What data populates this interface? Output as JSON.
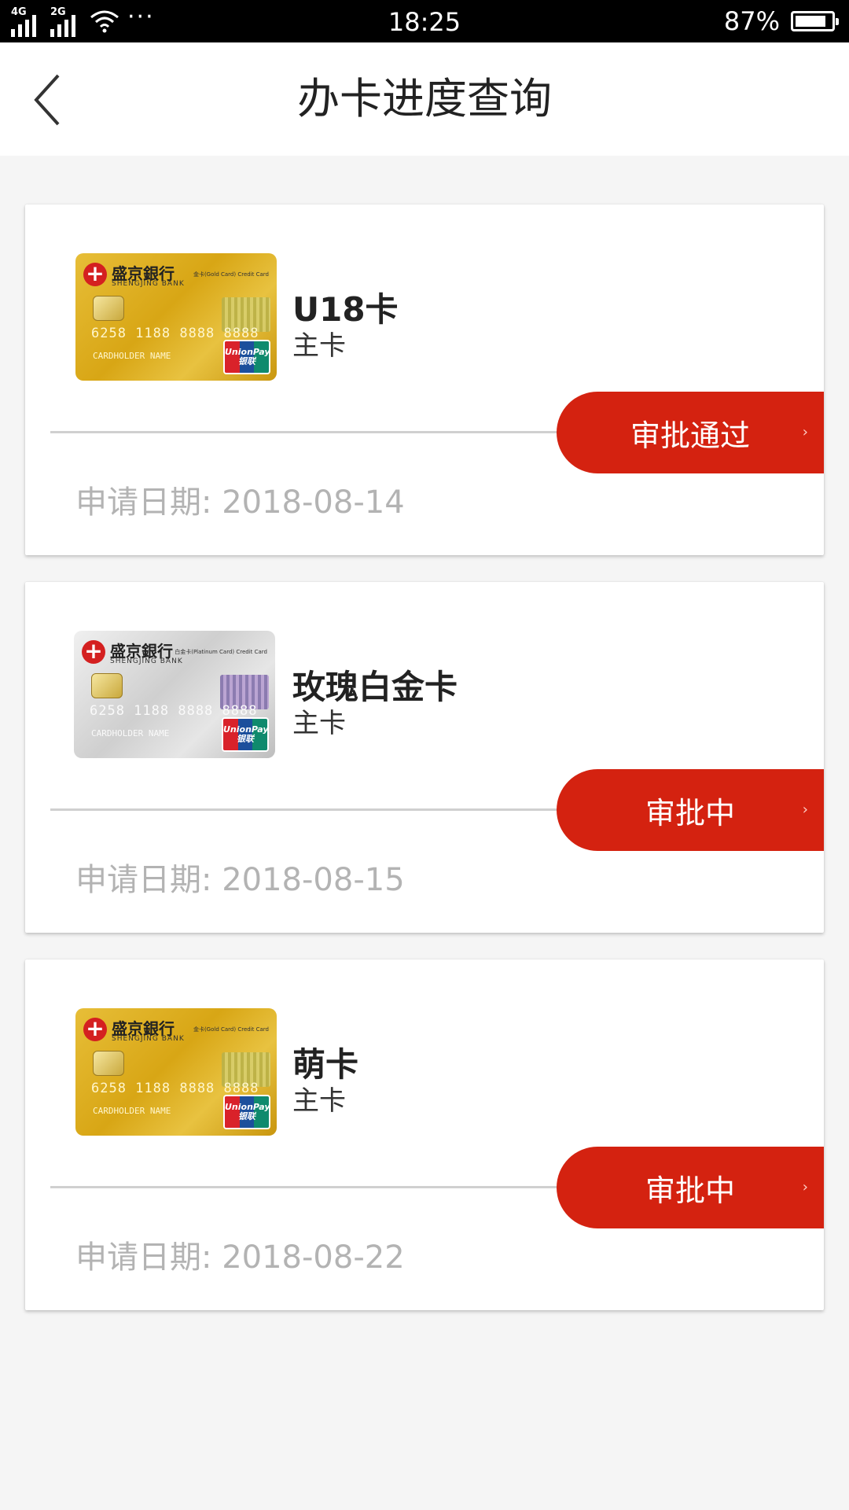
{
  "status_bar": {
    "network_1": "4G",
    "network_2": "2G",
    "more": "···",
    "time": "18:25",
    "battery_percent": "87%",
    "battery_level": 0.87
  },
  "header": {
    "title": "办卡进度查询",
    "back_icon": "chevron-left-icon"
  },
  "card_template": {
    "bank_name_cn": "盛京銀行",
    "bank_name_en": "SHENGJING BANK",
    "number": "6258 1188 8888 8888",
    "holder": "CARDHOLDER NAME",
    "unionpay": "UnionPay 银联"
  },
  "applications": [
    {
      "card_name": "U18卡",
      "card_kind": "主卡",
      "card_style": "gold",
      "card_tier": "金卡(Gold Card) Credit Card",
      "status": "审批通过",
      "date_label": "申请日期:",
      "date": "2018-08-14"
    },
    {
      "card_name": "玫瑰白金卡",
      "card_kind": "主卡",
      "card_style": "silver",
      "card_tier": "白金卡(Platinum Card) Credit Card",
      "status": "审批中",
      "date_label": "申请日期:",
      "date": "2018-08-15"
    },
    {
      "card_name": "萌卡",
      "card_kind": "主卡",
      "card_style": "gold",
      "card_tier": "金卡(Gold Card) Credit Card",
      "status": "审批中",
      "date_label": "申请日期:",
      "date": "2018-08-22"
    }
  ],
  "colors": {
    "accent_red": "#d42210",
    "background": "#f5f5f5",
    "date_gray": "#b3b3b3"
  }
}
